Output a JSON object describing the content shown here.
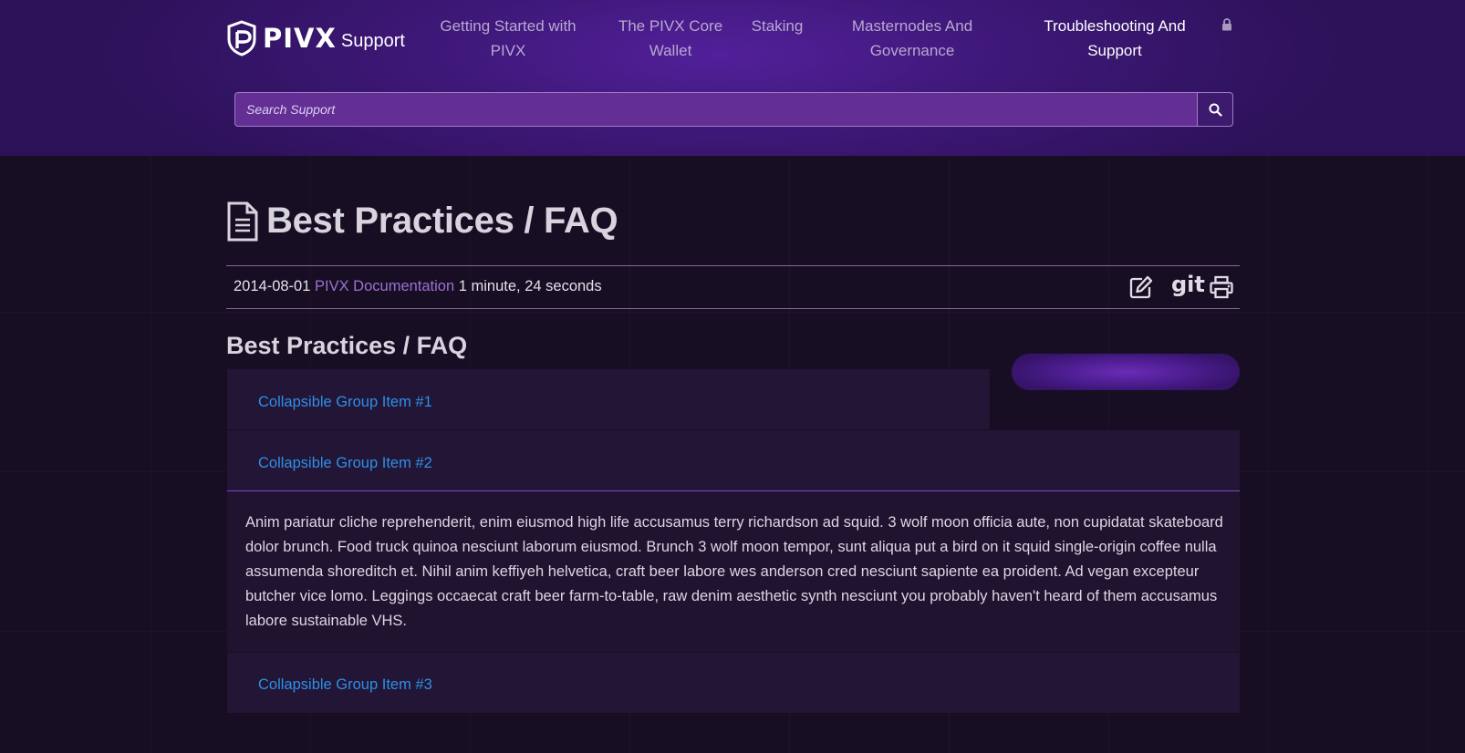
{
  "header": {
    "logo_word": "PIVX",
    "logo_sub": "Support",
    "nav": [
      {
        "label": "Getting Started with PIVX"
      },
      {
        "label": "The PIVX Core Wallet"
      },
      {
        "label": "Staking"
      },
      {
        "label": "Masternodes And Governance"
      },
      {
        "label": "Troubleshooting And Support",
        "active": true
      }
    ],
    "lock_icon": "lock-icon",
    "search": {
      "placeholder": "Search Support",
      "value": ""
    },
    "search_icon": "search-icon"
  },
  "page": {
    "title": "Best Practices / FAQ",
    "title_icon": "document-icon",
    "meta": {
      "date": "2014-08-01",
      "author": "PIVX Documentation",
      "read_time": "1 minute, 24 seconds"
    },
    "actions": [
      {
        "icon": "edit-icon"
      },
      {
        "icon": "git-icon",
        "label": "git"
      },
      {
        "icon": "print-icon"
      }
    ],
    "section_title": "Best Practices / FAQ",
    "accordion": [
      {
        "title": "Collapsible Group Item #1",
        "expanded": false
      },
      {
        "title": "Collapsible Group Item #2",
        "expanded": true,
        "body": "Anim pariatur cliche reprehenderit, enim eiusmod high life accusamus terry richardson ad squid. 3 wolf moon officia aute, non cupidatat skateboard dolor brunch. Food truck quinoa nesciunt laborum eiusmod. Brunch 3 wolf moon tempor, sunt aliqua put a bird on it squid single-origin coffee nulla assumenda shoreditch et. Nihil anim keffiyeh helvetica, craft beer labore wes anderson cred nesciunt sapiente ea proident. Ad vegan excepteur butcher vice lomo. Leggings occaecat craft beer farm-to-table, raw denim aesthetic synth nesciunt you probably haven't heard of them accusamus labore sustainable VHS."
      },
      {
        "title": "Collapsible Group Item #3",
        "expanded": false
      }
    ]
  },
  "colors": {
    "header_bg": "#3e1878",
    "page_bg": "#180e24",
    "card_bg": "#221535",
    "link_blue": "#2f8fe8",
    "meta_link": "#9b71d0",
    "search_bg": "#632f95",
    "divider": "#8a45c8"
  }
}
